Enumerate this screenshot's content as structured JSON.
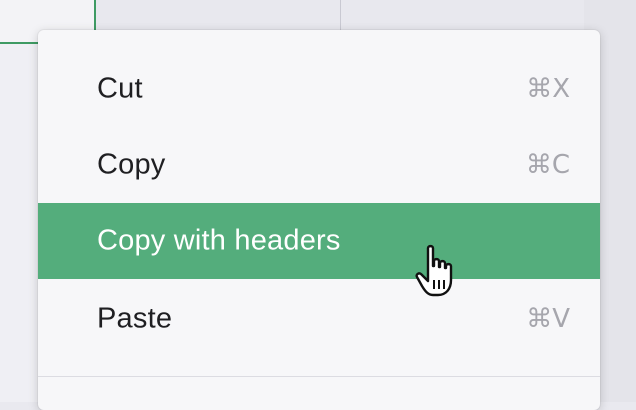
{
  "context_menu": {
    "items": [
      {
        "label": "Cut",
        "shortcut": "⌘X"
      },
      {
        "label": "Copy",
        "shortcut": "⌘C"
      },
      {
        "label": "Copy with headers",
        "shortcut": ""
      },
      {
        "label": "Paste",
        "shortcut": "⌘V"
      }
    ],
    "highlighted_index": 2
  },
  "colors": {
    "highlight": "#54ad7c",
    "selection_border": "#3e9a63",
    "shortcut_text": "#a6a6ad"
  },
  "cursor": {
    "icon": "hand-pointer-icon"
  }
}
